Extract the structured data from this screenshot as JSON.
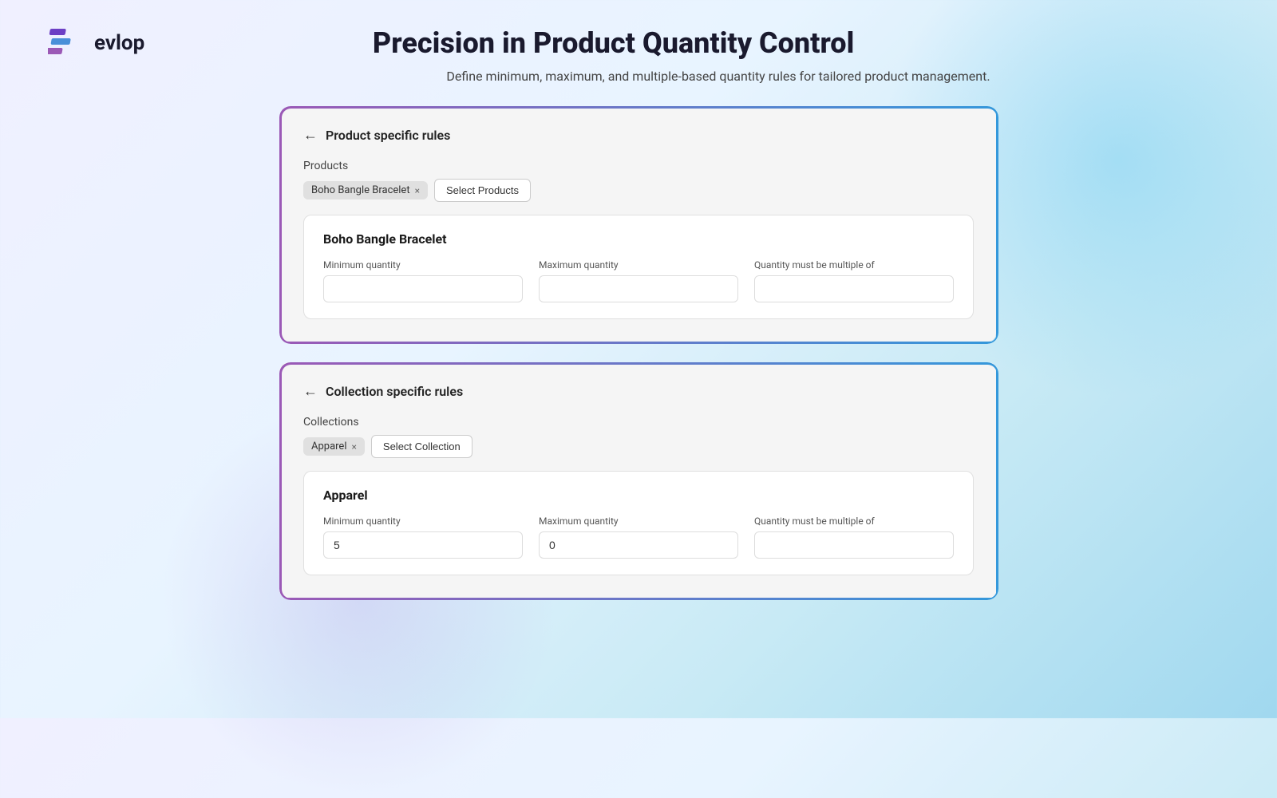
{
  "logo": {
    "text": "evlop"
  },
  "header": {
    "title": "Precision in Product Quantity Control",
    "subtitle": "Define minimum, maximum, and multiple-based quantity rules for tailored product management."
  },
  "productCard": {
    "backLabel": "←",
    "title": "Product specific rules",
    "sectionLabel": "Products",
    "tag": "Boho Bangle Bracelet",
    "selectButton": "Select Products",
    "detailsName": "Boho Bangle Bracelet",
    "minLabel": "Minimum quantity",
    "maxLabel": "Maximum quantity",
    "multipleLabel": "Quantity must be multiple of",
    "minValue": "",
    "maxValue": "",
    "multipleValue": ""
  },
  "collectionCard": {
    "backLabel": "←",
    "title": "Collection specific rules",
    "sectionLabel": "Collections",
    "tag": "Apparel",
    "selectButton": "Select Collection",
    "detailsName": "Apparel",
    "minLabel": "Minimum quantity",
    "maxLabel": "Maximum quantity",
    "multipleLabel": "Quantity must be multiple of",
    "minValue": "5",
    "maxValue": "0",
    "multipleValue": ""
  }
}
